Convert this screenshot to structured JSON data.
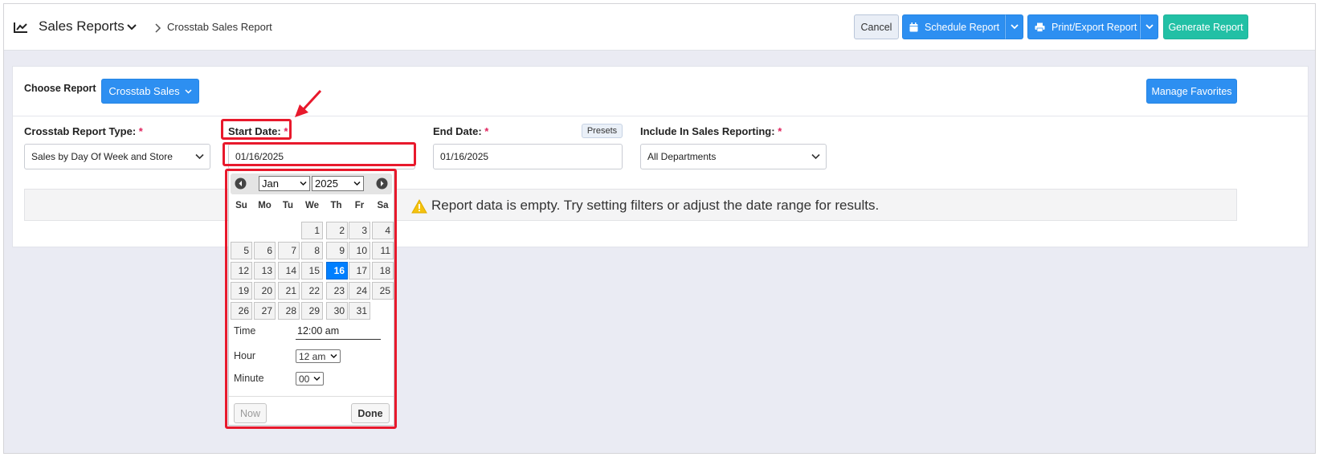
{
  "header": {
    "title": "Sales Reports",
    "breadcrumb": "Crosstab Sales Report",
    "cancel_label": "Cancel",
    "schedule_label": "Schedule Report",
    "print_label": "Print/Export Report",
    "generate_label": "Generate Report"
  },
  "choose": {
    "label": "Choose Report",
    "button_label": "Crosstab Sales",
    "manage_label": "Manage Favorites"
  },
  "fields": {
    "report_type_label": "Crosstab Report Type:",
    "report_type_value": "Sales by Day Of Week and Store",
    "start_label": "Start Date:",
    "start_value": "01/16/2025",
    "end_label": "End Date:",
    "end_value": "01/16/2025",
    "presets_label": "Presets",
    "include_label": "Include In Sales Reporting:",
    "include_value": "All Departments",
    "required_mark": "*"
  },
  "empty_message": "Report data is empty. Try setting filters or adjust the date range for results.",
  "datepicker": {
    "month": "Jan",
    "year": "2025",
    "weekdays": [
      "Su",
      "Mo",
      "Tu",
      "We",
      "Th",
      "Fr",
      "Sa"
    ],
    "days": [
      [
        "",
        "",
        "",
        "1",
        "2",
        "3",
        "4"
      ],
      [
        "5",
        "6",
        "7",
        "8",
        "9",
        "10",
        "11"
      ],
      [
        "12",
        "13",
        "14",
        "15",
        "16",
        "17",
        "18"
      ],
      [
        "19",
        "20",
        "21",
        "22",
        "23",
        "24",
        "25"
      ],
      [
        "26",
        "27",
        "28",
        "29",
        "30",
        "31",
        ""
      ]
    ],
    "selected_day": "16",
    "time_label": "Time",
    "time_value": "12:00 am",
    "hour_label": "Hour",
    "hour_value": "12 am",
    "minute_label": "Minute",
    "minute_value": "00",
    "now_label": "Now",
    "done_label": "Done"
  },
  "colors": {
    "primary": "#2d8ff1",
    "teal": "#22c0a5",
    "highlight": "#e8192c",
    "selected_day": "#007fff"
  }
}
